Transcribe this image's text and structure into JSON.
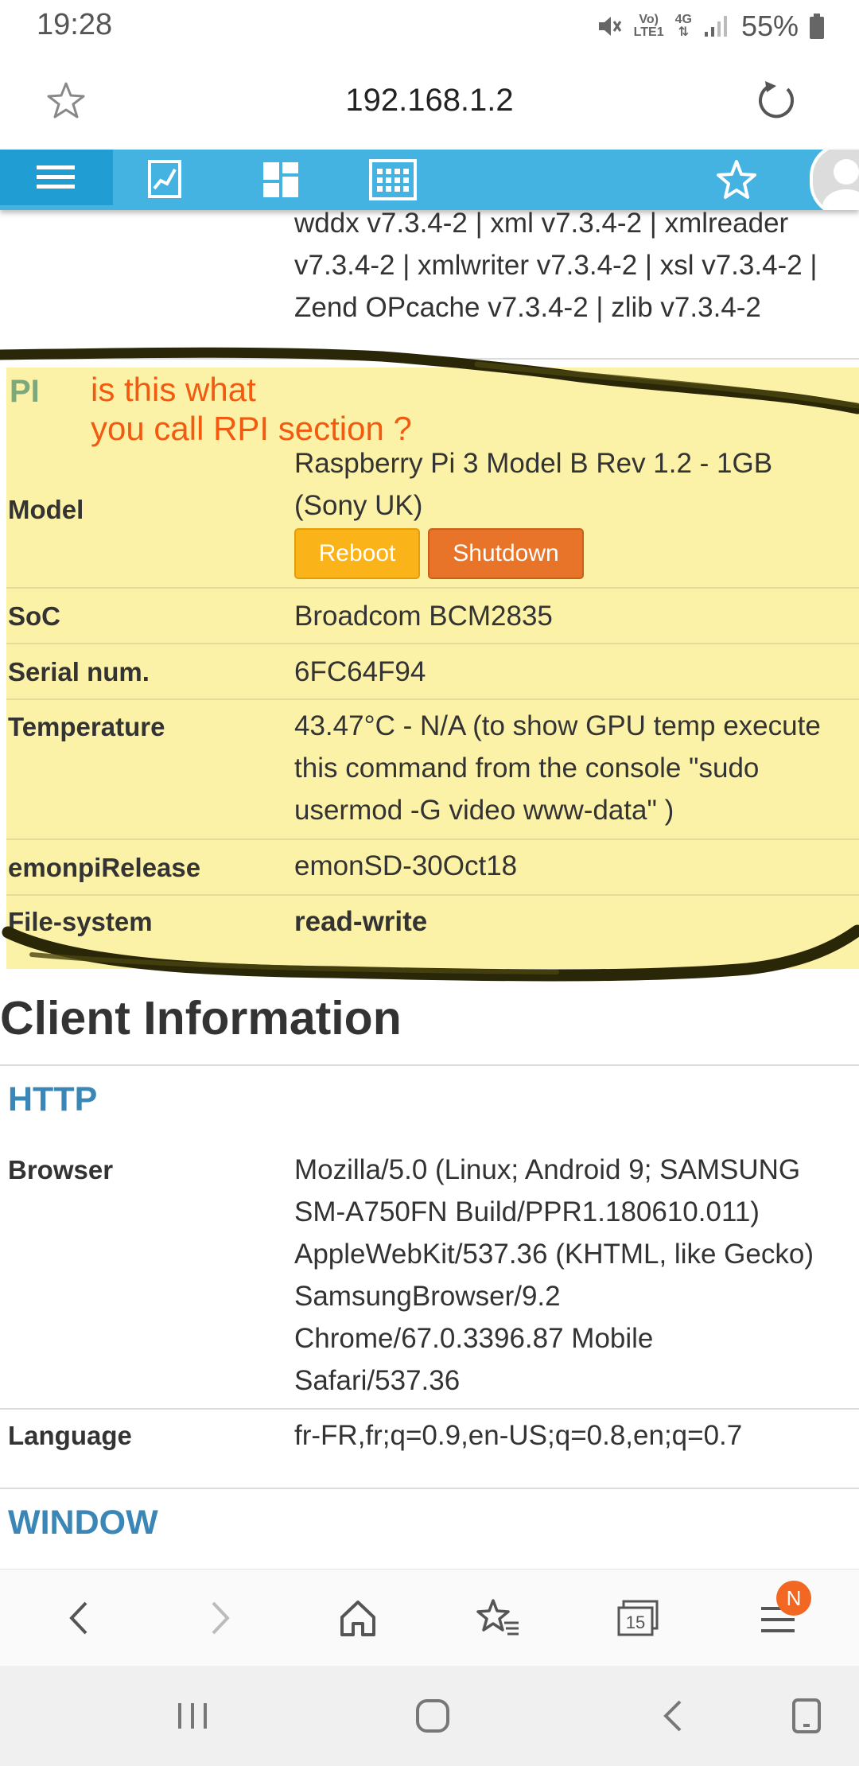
{
  "status_bar": {
    "time": "19:28",
    "volte": "Vo)",
    "lte": "LTE1",
    "net": "4G",
    "battery": "55%"
  },
  "browser": {
    "url": "192.168.1.2"
  },
  "php_modules_tail": [
    "wddx v7.3.4-2 | xml v7.3.4-2 | xmlreader",
    "v7.3.4-2 | xmlwriter v7.3.4-2 | xsl v7.3.4-2 |",
    "Zend OPcache v7.3.4-2 | zlib v7.3.4-2"
  ],
  "pi_section": {
    "header": "PI",
    "annotation": [
      "is this what",
      "you call RPI section ?"
    ],
    "model": {
      "key": "Model",
      "value": [
        "Raspberry Pi 3 Model B Rev 1.2 - 1GB",
        "(Sony UK)"
      ]
    },
    "buttons": {
      "reboot": "Reboot",
      "shutdown": "Shutdown"
    },
    "soc": {
      "key": "SoC",
      "value": "Broadcom BCM2835"
    },
    "serial": {
      "key": "Serial num.",
      "value": "6FC64F94"
    },
    "temperature": {
      "key": "Temperature",
      "value": [
        "43.47°C - N/A (to show GPU temp execute",
        "this command from the console \"sudo",
        "usermod -G video www-data\" )"
      ]
    },
    "release": {
      "key": "emonpiRelease",
      "value": "emonSD-30Oct18"
    },
    "filesystem": {
      "key": "File-system",
      "value": "read-write"
    }
  },
  "client": {
    "title": "Client Information",
    "http_header": "HTTP",
    "browser": {
      "key": "Browser",
      "value": [
        "Mozilla/5.0 (Linux; Android 9; SAMSUNG",
        "SM-A750FN Build/PPR1.180610.011)",
        "AppleWebKit/537.36 (KHTML, like Gecko)",
        "SamsungBrowser/9.2",
        "Chrome/67.0.3396.87 Mobile",
        "Safari/537.36"
      ]
    },
    "language": {
      "key": "Language",
      "value": "fr-FR,fr;q=0.9,en-US;q=0.8,en;q=0.7"
    },
    "window_header": "WINDOW"
  },
  "toolbar": {
    "tab_count": "15",
    "notification_badge": "N"
  },
  "icons": {
    "nav": [
      "menu-icon",
      "graph-icon",
      "dashboard-icon",
      "apps-icon",
      "favorite-star-icon",
      "user-avatar-icon"
    ],
    "toolbar": [
      "back-icon",
      "forward-icon",
      "home-icon",
      "bookmarks-icon",
      "tabs-icon",
      "menu-icon"
    ],
    "system": [
      "recents-icon",
      "home-icon",
      "back-icon",
      "screenshot-icon"
    ]
  },
  "colors": {
    "nav_blue": "#44b3e2",
    "nav_active": "#209ed3",
    "highlight": "#fbf1a7",
    "annotation": "#f25a10",
    "section_blue": "#3a86b6",
    "reboot": "#fbb31a",
    "shutdown": "#e8742a"
  }
}
